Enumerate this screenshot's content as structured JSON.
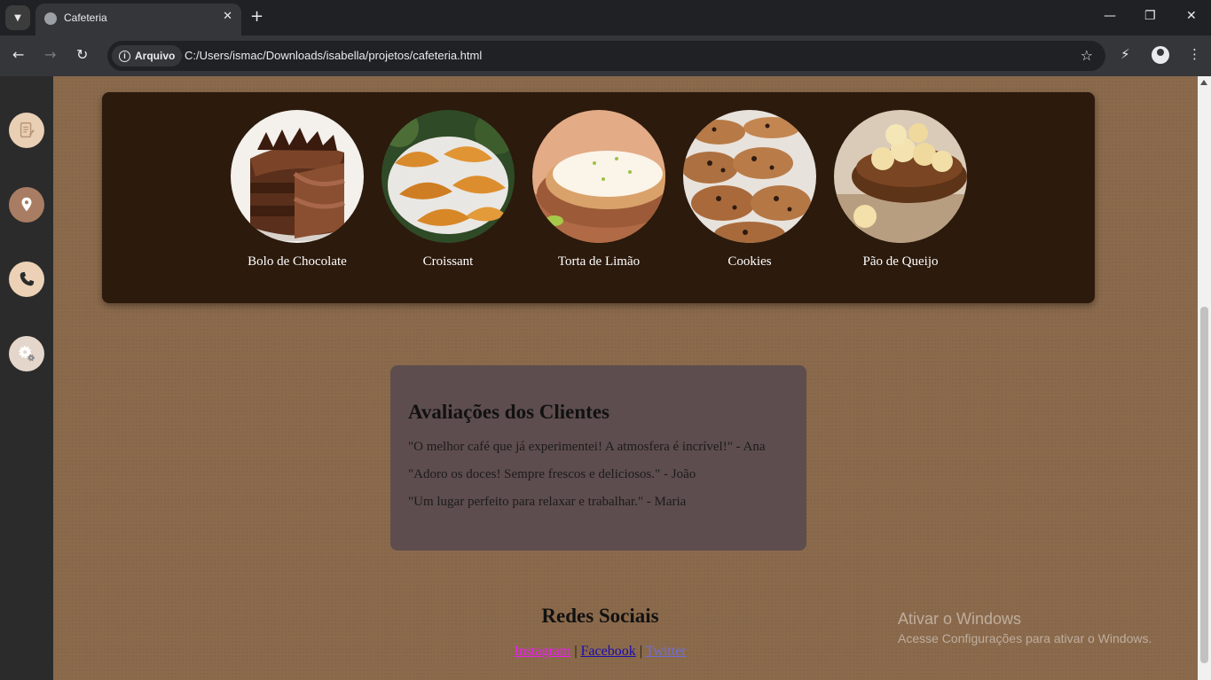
{
  "browser": {
    "tab_title": "Cafeteria",
    "chip_label": "Arquivo",
    "url": "C:/Users/ismac/Downloads/isabella/projetos/cafeteria.html"
  },
  "sidebar": {
    "items": [
      {
        "icon": "menu-document-icon",
        "bg": "#e9cfb4"
      },
      {
        "icon": "location-pin-icon",
        "bg": "#a97d63"
      },
      {
        "icon": "phone-icon",
        "bg": "#ecd1b6"
      },
      {
        "icon": "settings-gear-icon",
        "bg": "#e5d6cb"
      }
    ]
  },
  "menu": {
    "items": [
      {
        "label": "Bolo de Chocolate",
        "image": "chocolate-cake"
      },
      {
        "label": "Croissant",
        "image": "croissants"
      },
      {
        "label": "Torta de Limão",
        "image": "lemon-tart"
      },
      {
        "label": "Cookies",
        "image": "cookies"
      },
      {
        "label": "Pão de Queijo",
        "image": "cheese-bread"
      }
    ]
  },
  "reviews": {
    "title": "Avaliações dos Clientes",
    "quotes": [
      "\"O melhor café que já experimentei! A atmosfera é incrível!\" - Ana",
      "\"Adoro os doces! Sempre frescos e deliciosos.\" - João",
      "\"Um lugar perfeito para relaxar e trabalhar.\" - Maria"
    ]
  },
  "social": {
    "title": "Redes Sociais",
    "links": [
      "Instagram",
      "Facebook",
      "Twitter"
    ],
    "separator": "|",
    "colors": {
      "instagram": "#e91ef0",
      "facebook": "#1a0dab",
      "twitter": "#6f6fd6"
    }
  },
  "watermark": {
    "title": "Ativar o Windows",
    "subtitle": "Acesse Configurações para ativar o Windows."
  }
}
